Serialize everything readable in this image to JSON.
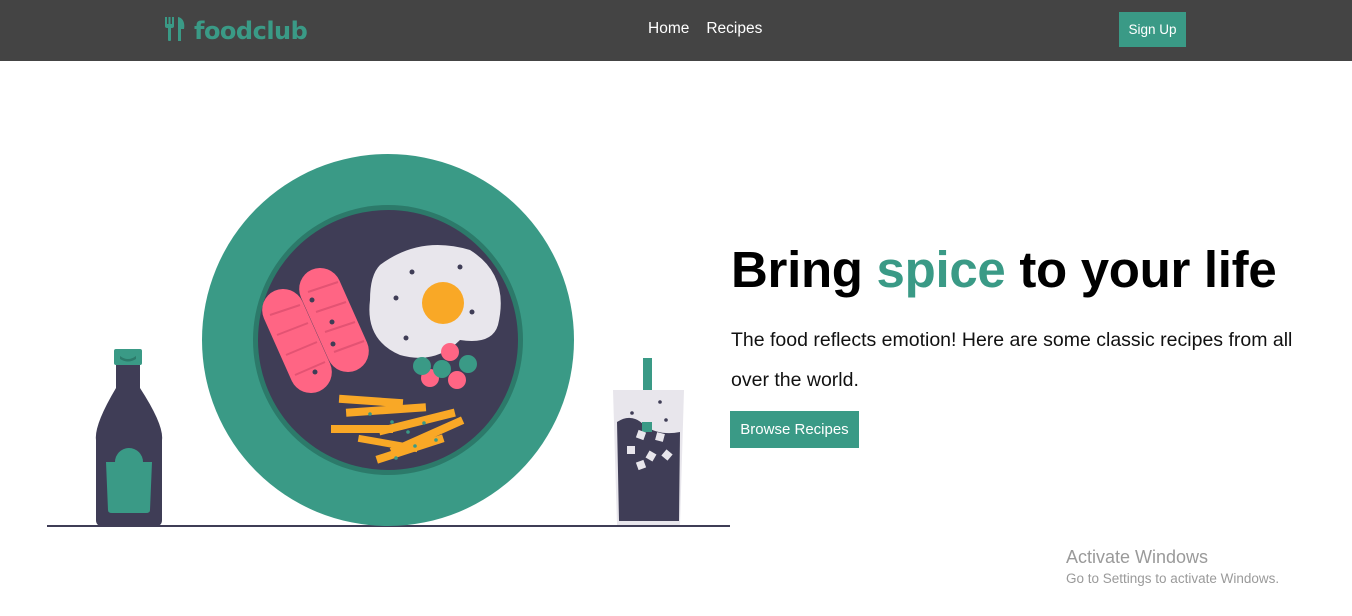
{
  "nav": {
    "brand": "foodclub",
    "links": [
      "Home",
      "Recipes"
    ],
    "signup_label": "Sign Up"
  },
  "hero": {
    "title_pre": "Bring ",
    "title_accent": "spice",
    "title_post": " to your life",
    "description": "The food reflects emotion! Here are some classic recipes from all over the world.",
    "button_label": "Browse Recipes"
  },
  "watermark": {
    "title": "Activate Windows",
    "subtitle": "Go to Settings to activate Windows."
  },
  "colors": {
    "accent": "#3a9a86",
    "navbar": "#444444",
    "plate_inner": "#3f3d56",
    "sausage": "#ff6584",
    "yolk": "#f9a826"
  },
  "icons": {
    "brand": "fork-knife-icon"
  }
}
